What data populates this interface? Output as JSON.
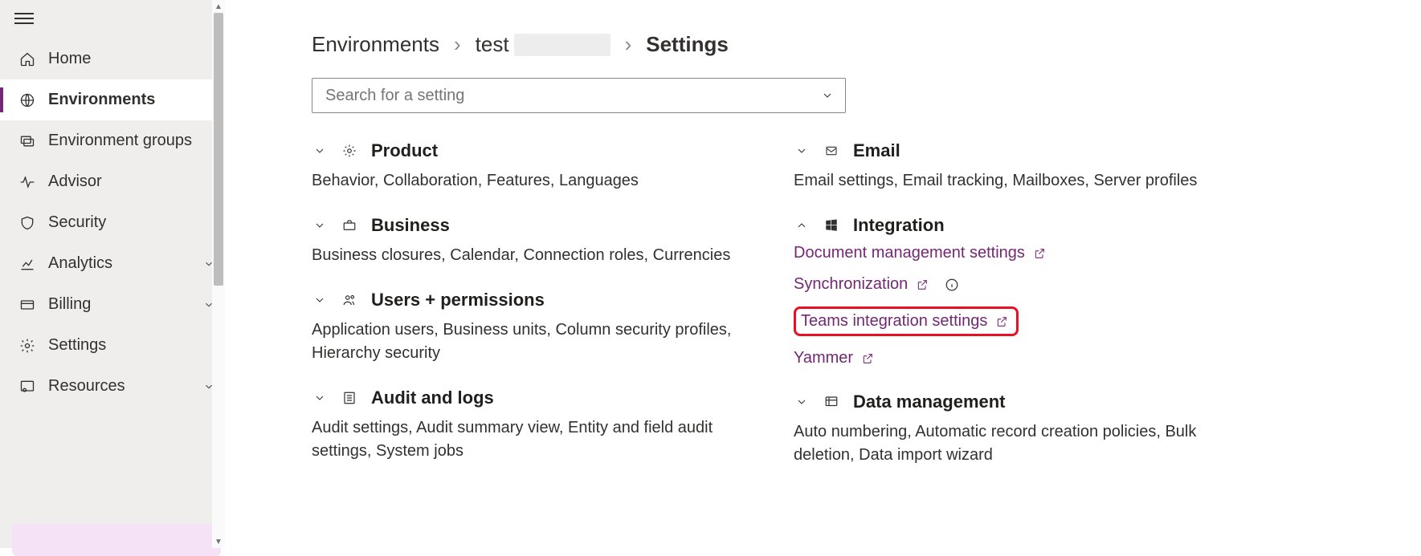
{
  "sidebar": {
    "items": [
      {
        "label": "Home"
      },
      {
        "label": "Environments"
      },
      {
        "label": "Environment groups"
      },
      {
        "label": "Advisor"
      },
      {
        "label": "Security"
      },
      {
        "label": "Analytics"
      },
      {
        "label": "Billing"
      },
      {
        "label": "Settings"
      },
      {
        "label": "Resources"
      }
    ]
  },
  "breadcrumb": {
    "root": "Environments",
    "env_prefix": "test",
    "current": "Settings"
  },
  "search": {
    "placeholder": "Search for a setting"
  },
  "sections": {
    "product": {
      "title": "Product",
      "subtitle": "Behavior, Collaboration, Features, Languages"
    },
    "business": {
      "title": "Business",
      "subtitle": "Business closures, Calendar, Connection roles, Currencies"
    },
    "users": {
      "title": "Users + permissions",
      "subtitle": "Application users, Business units, Column security profiles, Hierarchy security"
    },
    "audit": {
      "title": "Audit and logs",
      "subtitle": "Audit settings, Audit summary view, Entity and field audit settings, System jobs"
    },
    "email": {
      "title": "Email",
      "subtitle": "Email settings, Email tracking, Mailboxes, Server profiles"
    },
    "integration": {
      "title": "Integration",
      "links": {
        "doc_mgmt": "Document management settings",
        "sync": "Synchronization",
        "teams": "Teams integration settings",
        "yammer": "Yammer"
      }
    },
    "data": {
      "title": "Data management",
      "subtitle": "Auto numbering, Automatic record creation policies, Bulk deletion, Data import wizard"
    }
  }
}
